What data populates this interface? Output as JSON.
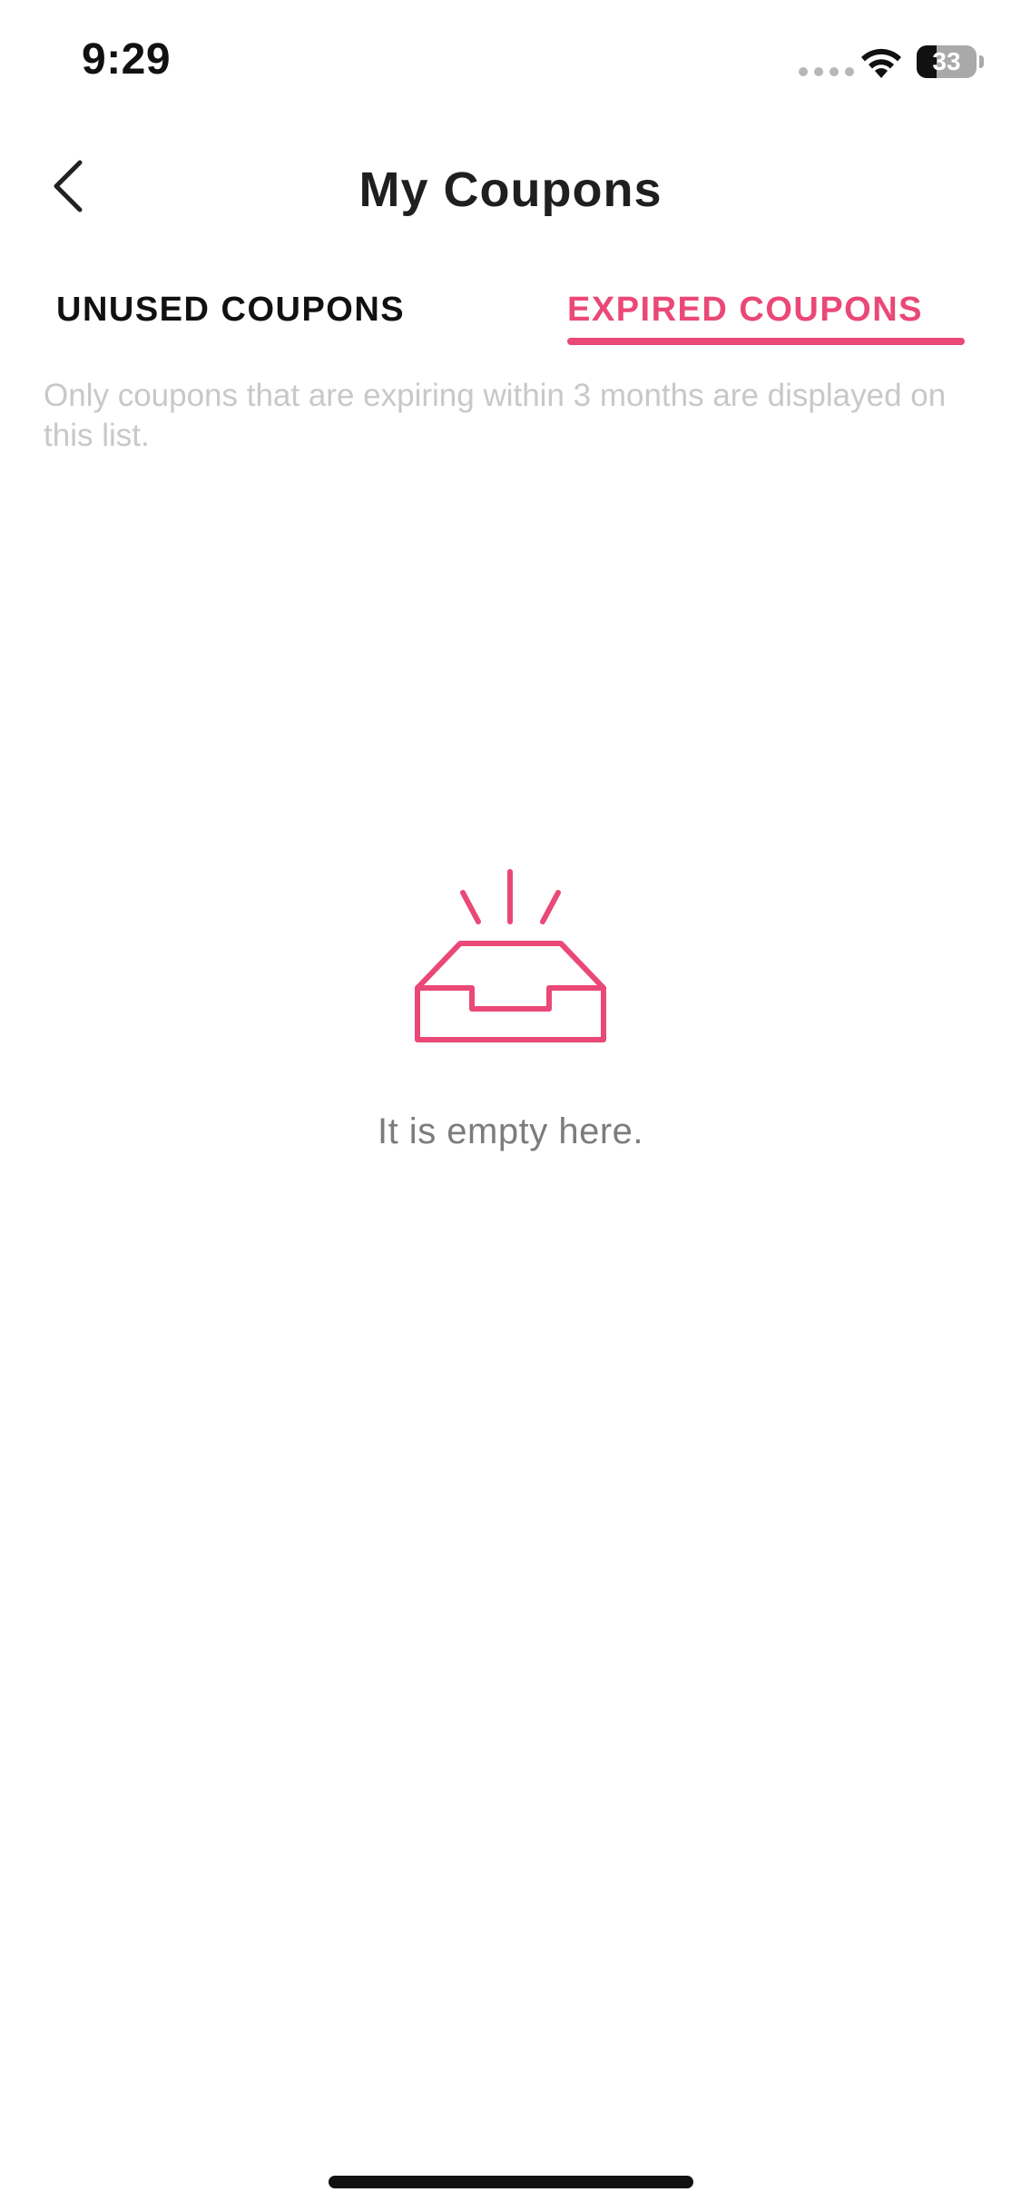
{
  "status_bar": {
    "time": "9:29",
    "battery_level": "33",
    "battery_fraction": 0.33
  },
  "header": {
    "title": "My Coupons",
    "back_icon": "chevron-left-icon"
  },
  "tabs": [
    {
      "label": "UNUSED COUPONS",
      "active": false
    },
    {
      "label": "EXPIRED COUPONS",
      "active": true
    }
  ],
  "info_text": "Only coupons that are expiring within 3 months are displayed on this list.",
  "empty_state": {
    "icon": "empty-inbox-icon",
    "message": "It is empty here."
  },
  "colors": {
    "accent": "#ea4877",
    "title": "#1f1f1f",
    "info_text": "#c8c8c8",
    "empty_text": "#7c7c7c"
  }
}
